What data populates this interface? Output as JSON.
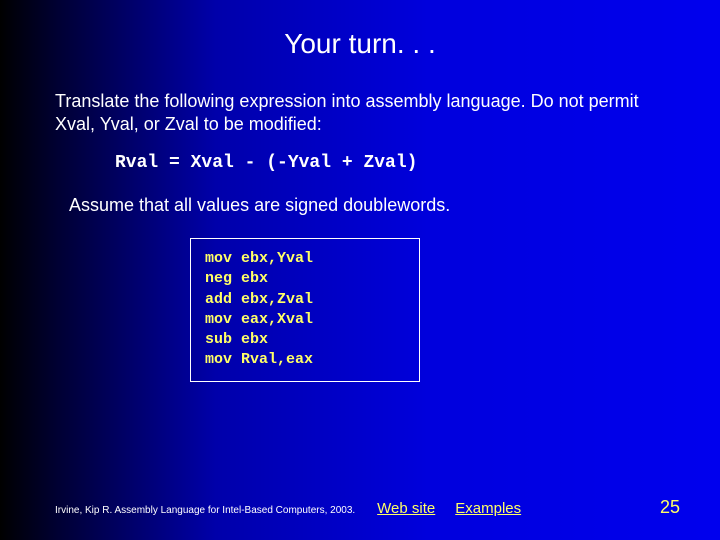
{
  "title": "Your turn. . .",
  "instruction": "Translate the following expression into assembly language. Do not permit Xval, Yval, or Zval to be modified:",
  "expression": "Rval = Xval - (-Yval + Zval)",
  "assume": "Assume that all values are signed doublewords.",
  "code": "mov ebx,Yval\nneg ebx\nadd ebx,Zval\nmov eax,Xval\nsub ebx\nmov Rval,eax",
  "footer": {
    "credit": "Irvine, Kip R. Assembly Language for Intel-Based Computers, 2003.",
    "web_link": "Web site",
    "examples_link": "Examples",
    "page_number": "25"
  }
}
